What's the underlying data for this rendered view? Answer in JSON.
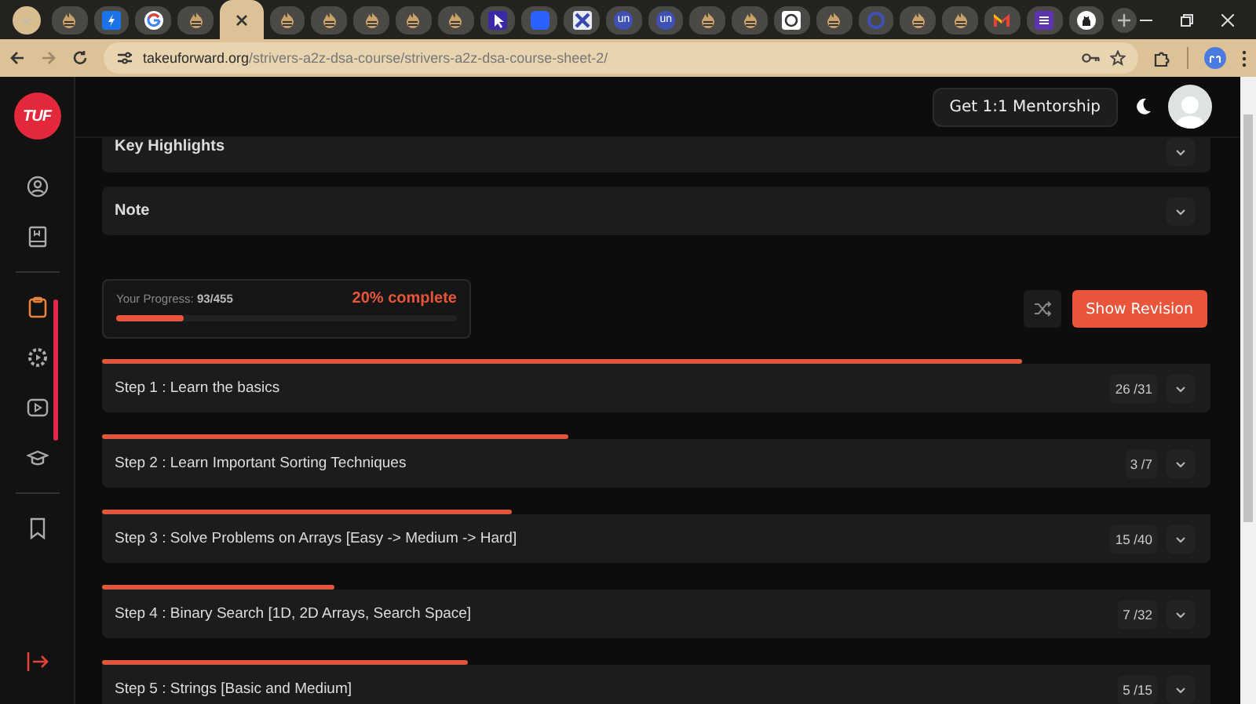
{
  "browser": {
    "tabs": [
      {
        "kind": "tuf",
        "selected": false
      },
      {
        "kind": "bolt",
        "selected": false
      },
      {
        "kind": "google",
        "selected": false
      },
      {
        "kind": "tuf",
        "selected": false
      },
      {
        "kind": "close",
        "selected": true
      },
      {
        "kind": "tuf",
        "selected": false
      },
      {
        "kind": "tuf",
        "selected": false
      },
      {
        "kind": "tuf",
        "selected": false
      },
      {
        "kind": "tuf",
        "selected": false
      },
      {
        "kind": "tuf",
        "selected": false
      },
      {
        "kind": "cursor",
        "selected": false
      },
      {
        "kind": "square",
        "selected": false
      },
      {
        "kind": "cross",
        "selected": false
      },
      {
        "kind": "letters",
        "text": "un",
        "selected": false
      },
      {
        "kind": "letters",
        "text": "un",
        "selected": false
      },
      {
        "kind": "tuf",
        "selected": false
      },
      {
        "kind": "tuf",
        "selected": false
      },
      {
        "kind": "gear",
        "selected": false
      },
      {
        "kind": "tuf",
        "selected": false
      },
      {
        "kind": "ring",
        "selected": false
      },
      {
        "kind": "tuf",
        "selected": false
      },
      {
        "kind": "tuf",
        "selected": false
      },
      {
        "kind": "mail",
        "selected": false
      },
      {
        "kind": "list",
        "selected": false
      },
      {
        "kind": "github",
        "selected": false
      }
    ],
    "address": {
      "host": "takeuforward.org",
      "path": "/strivers-a2z-dsa-course/strivers-a2z-dsa-course-sheet-2/"
    }
  },
  "sidebar": {
    "logo": "TUF",
    "groups": [
      [
        {
          "kind": "user",
          "selected": false
        },
        {
          "kind": "book",
          "selected": false
        }
      ],
      [
        {
          "kind": "clipboard",
          "selected": true
        },
        {
          "kind": "gear",
          "selected": false
        },
        {
          "kind": "play",
          "selected": false
        },
        {
          "kind": "cap",
          "selected": false
        }
      ],
      [
        {
          "kind": "bookmark",
          "selected": false
        }
      ]
    ]
  },
  "header": {
    "mentorship_button": "Get 1:1 Mentorship"
  },
  "sections": [
    {
      "title": "Key Highlights"
    },
    {
      "title": "Note"
    }
  ],
  "progress": {
    "label": "Your Progress:",
    "count": "93/455",
    "level": 0.2,
    "percent": "20% complete"
  },
  "revision_button": "Show Revision",
  "steps": [
    {
      "title": "Step 1 : Learn the basics",
      "count": "26 /31",
      "level": 0.83
    },
    {
      "title": "Step 2 : Learn Important Sorting Techniques",
      "count": "3 /7",
      "level": 0.42
    },
    {
      "title": "Step 3 : Solve Problems on Arrays [Easy -> Medium -> Hard]",
      "count": "15 /40",
      "level": 0.37
    },
    {
      "title": "Step 4 : Binary Search [1D, 2D Arrays, Search Space]",
      "count": "7 /32",
      "level": 0.21
    },
    {
      "title": "Step 5 : Strings [Basic and Medium]",
      "count": "5 /15",
      "level": 0.33
    }
  ]
}
